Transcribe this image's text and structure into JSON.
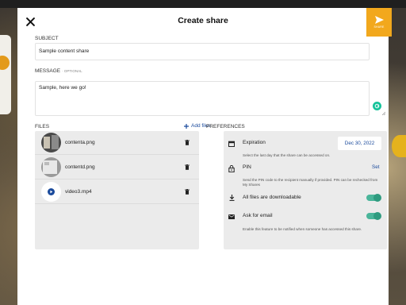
{
  "header": {
    "title": "Create share",
    "share_label": "SHARE"
  },
  "subject": {
    "label": "SUBJECT",
    "value": "Sample content share"
  },
  "message": {
    "label": "MESSAGE",
    "optional": "· OPTIONAL",
    "value": "Sample, here we go!"
  },
  "files": {
    "label": "FILES",
    "add_label": "Add files",
    "items": [
      {
        "name": "contenta.png",
        "icon": "image-thumbnail"
      },
      {
        "name": "contentd.png",
        "icon": "image-thumbnail"
      },
      {
        "name": "video3.mp4",
        "icon": "play-icon"
      }
    ]
  },
  "preferences": {
    "label": "PREFERENCES",
    "expiration": {
      "label": "Expiration",
      "date": "Dec 30, 2022",
      "description": "Select the last day that the share can be accessed on."
    },
    "pin": {
      "label": "PIN",
      "action": "Set",
      "description": "Send the PIN code to the recipient manually if provided. PIN can be rechecked from My Shares"
    },
    "downloadable": {
      "label": "All files are downloadable",
      "enabled": true
    },
    "ask_email": {
      "label": "Ask for email",
      "enabled": true,
      "description": "Enable this feature to be notified when someone has accessed this share."
    }
  },
  "colors": {
    "accent": "#f2a81d",
    "link": "#1a4a9c",
    "toggle": "#2e9b7f"
  }
}
